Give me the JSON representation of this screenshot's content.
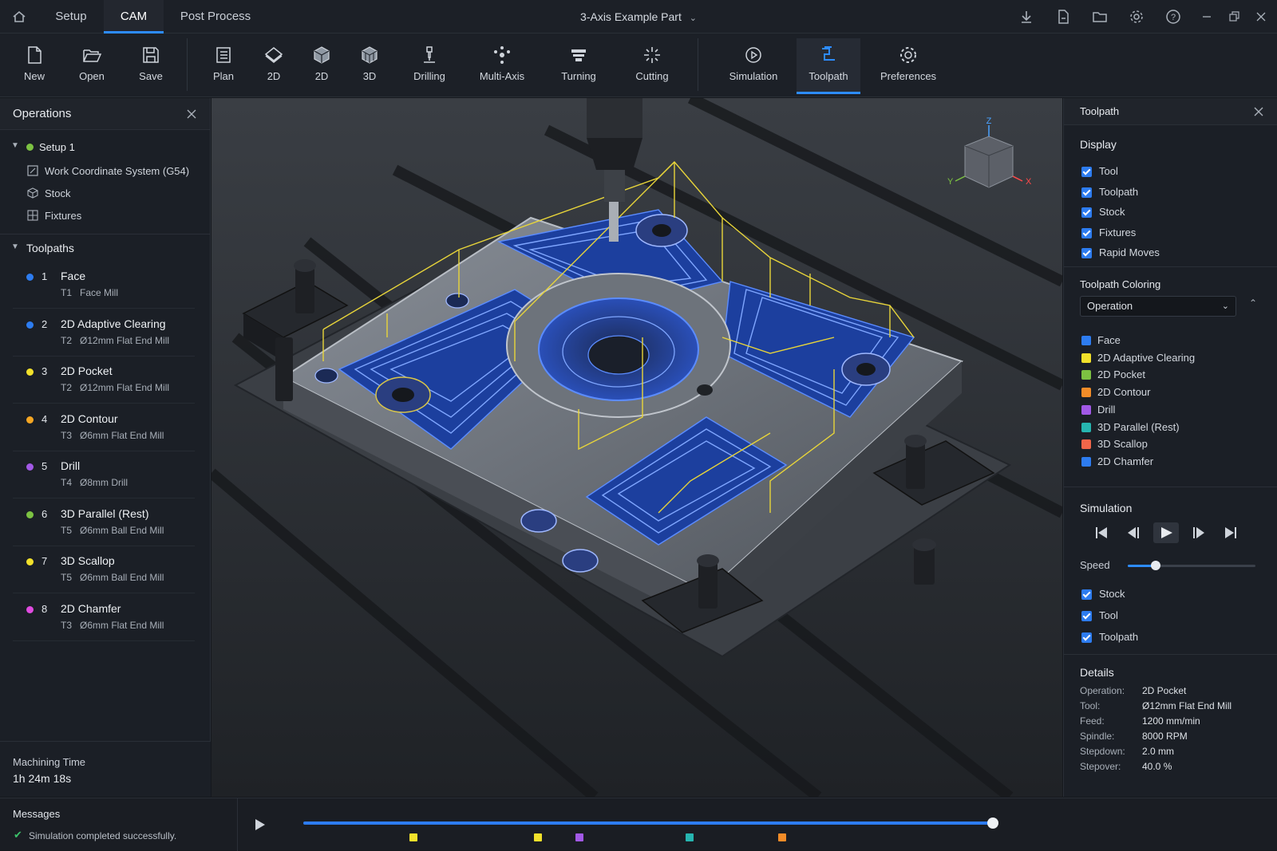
{
  "topbar": {
    "tabs": [
      "Setup",
      "CAM",
      "Post Process"
    ],
    "active_tab": "CAM",
    "document_title": "3-Axis Example Part"
  },
  "ribbon": {
    "buttons": [
      {
        "label": "New",
        "icon": "new-file-icon"
      },
      {
        "label": "Open",
        "icon": "folder-open-icon"
      },
      {
        "label": "Save",
        "icon": "save-icon"
      },
      {
        "label": "Plan",
        "icon": "plan-icon"
      },
      {
        "label": "2D",
        "icon": "2d-diamond-icon"
      },
      {
        "label": "2D",
        "icon": "2d-cube-icon"
      },
      {
        "label": "3D",
        "icon": "3d-cube-icon"
      },
      {
        "label": "Drilling",
        "icon": "drill-icon"
      },
      {
        "label": "Multi-Axis",
        "icon": "multi-axis-icon"
      },
      {
        "label": "Turning",
        "icon": "turning-icon"
      },
      {
        "label": "Cutting",
        "icon": "cutting-icon"
      },
      {
        "label": "Simulation",
        "icon": "simulation-icon"
      },
      {
        "label": "Toolpath",
        "icon": "toolpath-icon"
      },
      {
        "label": "Preferences",
        "icon": "gear-icon"
      }
    ],
    "active": "Toolpath"
  },
  "operations": {
    "title": "Operations",
    "setup": {
      "name": "Setup 1",
      "items": [
        "Work Coordinate System (G54)",
        "Stock",
        "Fixtures"
      ]
    },
    "toolpaths_title": "Toolpaths",
    "toolpaths": [
      {
        "num": "1",
        "name": "Face",
        "tool": "T1   Face Mill",
        "color": "#2d7cf0"
      },
      {
        "num": "2",
        "name": "2D Adaptive Clearing",
        "tool": "T2   Ø12mm Flat End Mill",
        "color": "#2d7cf0"
      },
      {
        "num": "3",
        "name": "2D Pocket",
        "tool": "T2   Ø12mm Flat End Mill",
        "color": "#f2e12b"
      },
      {
        "num": "4",
        "name": "2D Contour",
        "tool": "T3   Ø6mm Flat End Mill",
        "color": "#f5a623"
      },
      {
        "num": "5",
        "name": "Drill",
        "tool": "T4   Ø8mm Drill",
        "color": "#a259e6"
      },
      {
        "num": "6",
        "name": "3D Parallel (Rest)",
        "tool": "T5   Ø6mm Ball End Mill",
        "color": "#7cc242"
      },
      {
        "num": "7",
        "name": "3D Scallop",
        "tool": "T5   Ø6mm Ball End Mill",
        "color": "#f2e12b"
      },
      {
        "num": "8",
        "name": "2D Chamfer",
        "tool": "T3   Ø6mm Flat End Mill",
        "color": "#e04be0"
      }
    ],
    "machining_time_label": "Machining Time",
    "machining_time": "1h 24m 18s"
  },
  "toolpath_panel": {
    "title": "Toolpath",
    "display_title": "Display",
    "display_items": [
      "Tool",
      "Toolpath",
      "Stock",
      "Fixtures",
      "Rapid Moves"
    ],
    "coloring_title": "Toolpath Coloring",
    "coloring_value": "Operation",
    "legend": [
      {
        "label": "Face",
        "color": "#2d7cf0"
      },
      {
        "label": "2D Adaptive Clearing",
        "color": "#f2e12b"
      },
      {
        "label": "2D Pocket",
        "color": "#7cc242"
      },
      {
        "label": "2D Contour",
        "color": "#f28c28"
      },
      {
        "label": "Drill",
        "color": "#a259e6"
      },
      {
        "label": "3D Parallel (Rest)",
        "color": "#26b5b0"
      },
      {
        "label": "3D Scallop",
        "color": "#f0664a"
      },
      {
        "label": "2D Chamfer",
        "color": "#2d7cf0"
      }
    ],
    "simulation_title": "Simulation",
    "speed_label": "Speed",
    "speed_fraction": 0.22,
    "sim_items": [
      "Stock",
      "Tool",
      "Toolpath"
    ],
    "details_title": "Details",
    "details": [
      {
        "label": "Operation:",
        "value": "2D Pocket"
      },
      {
        "label": "Tool:",
        "value": "Ø12mm Flat End Mill"
      },
      {
        "label": "Feed:",
        "value": "1200 mm/min"
      },
      {
        "label": "Spindle:",
        "value": "8000 RPM"
      },
      {
        "label": "Stepdown:",
        "value": "2.0 mm"
      },
      {
        "label": "Stepover:",
        "value": "40.0 %"
      }
    ]
  },
  "viewcube": {
    "x": "X",
    "y": "Y",
    "z": "Z"
  },
  "messages": {
    "title": "Messages",
    "text": "Simulation completed successfully."
  },
  "timeline": {
    "progress": 1.0,
    "markers": [
      {
        "pos": 0.16,
        "color": "#f2e12b"
      },
      {
        "pos": 0.34,
        "color": "#f2e12b"
      },
      {
        "pos": 0.4,
        "color": "#a259e6"
      },
      {
        "pos": 0.56,
        "color": "#26b5b0"
      },
      {
        "pos": 0.695,
        "color": "#f28c28"
      }
    ]
  }
}
